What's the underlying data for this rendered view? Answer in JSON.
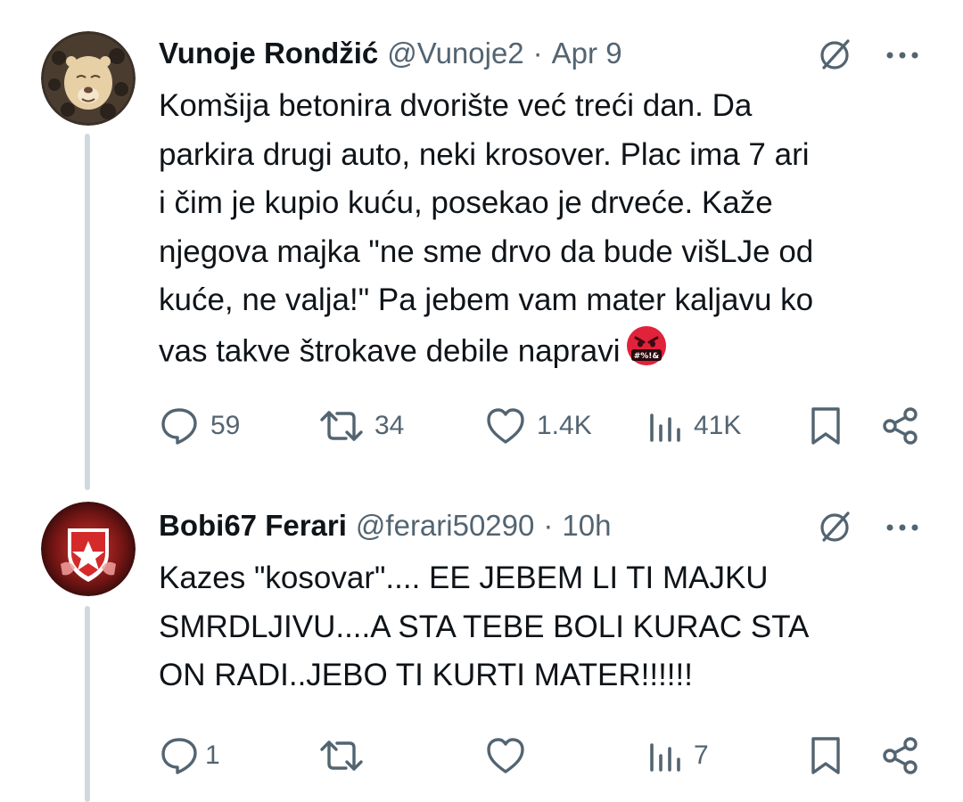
{
  "tweets": [
    {
      "author_name": "Vunoje Rondžić",
      "handle": "@Vunoje2",
      "separator": "·",
      "time": "Apr 9",
      "lines": [
        "Komšija betonira dvorište već treći dan. Da",
        "parkira drugi auto, neki krosover. Plac ima 7 ari",
        "i čim je kupio kuću, posekao je drveće. Kaže",
        "njegova majka \"ne sme drvo da bude višLJe od",
        "kuće, ne valja!\" Pa jebem vam mater kaljavu ko",
        "vas takve štrokave debile napravi"
      ],
      "emoji_text": "#%!&",
      "stats": {
        "replies": "59",
        "reposts": "34",
        "likes": "1.4K",
        "views": "41K"
      }
    },
    {
      "author_name": "Bobi67 Ferari",
      "handle": "@ferari50290",
      "separator": "·",
      "time": "10h",
      "lines": [
        "Kazes \"kosovar\".... EE JEBEM LI TI MAJKU",
        "SMRDLJIVU....A STA TEBE BOLI KURAC STA",
        "ON RADI..JEBO TI KURTI MATER!!!!!!"
      ],
      "stats": {
        "replies": "1",
        "reposts": "",
        "likes": "",
        "views": "7"
      }
    }
  ],
  "colors": {
    "text": "#0f1419",
    "secondary": "#536471",
    "thread_line": "#cfd9de",
    "emoji_red": "#e0223a"
  },
  "icons": [
    "reply-icon",
    "repost-icon",
    "like-icon",
    "views-icon",
    "bookmark-icon",
    "share-icon",
    "grok-icon",
    "more-icon"
  ]
}
